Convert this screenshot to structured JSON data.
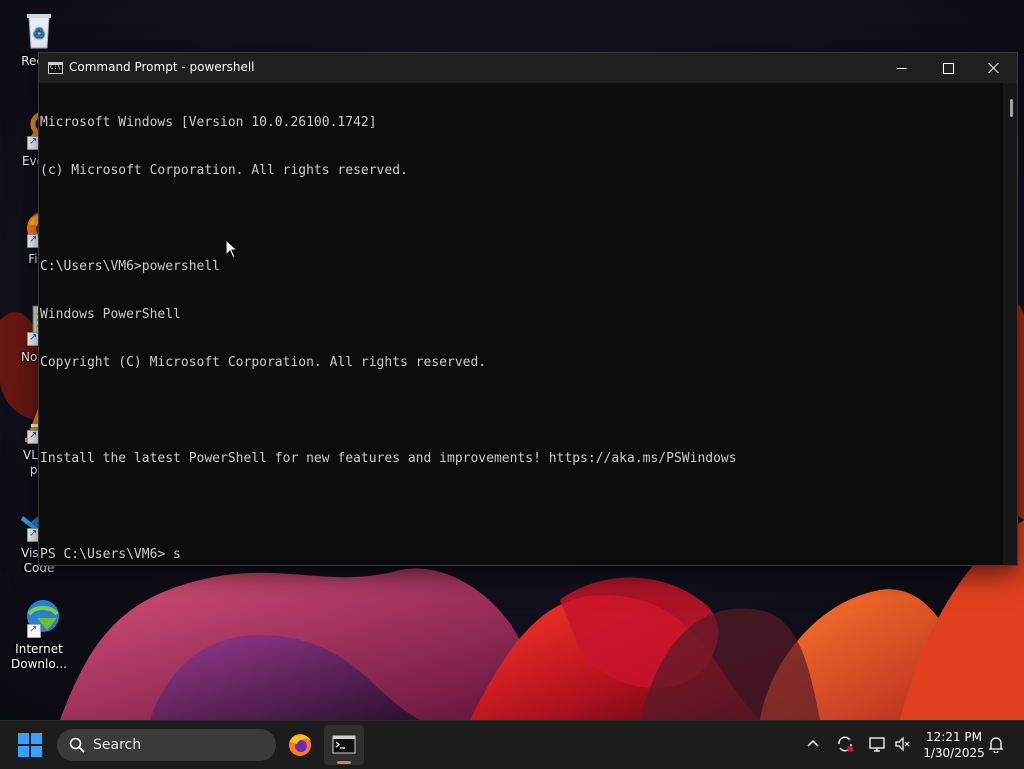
{
  "desktop": {
    "icons": [
      {
        "label": "Recyc",
        "icon": "recycle-bin-icon"
      },
      {
        "label": "Every",
        "icon": "everything-search-icon"
      },
      {
        "label": "Fire",
        "icon": "firefox-icon"
      },
      {
        "label": "Notep",
        "icon": "notepad-icon"
      },
      {
        "label_line1": "VLC r",
        "label_line2": "pla",
        "icon": "vlc-icon"
      },
      {
        "label_line1": "Visual",
        "label_line2": "Code",
        "icon": "vscode-icon"
      },
      {
        "label_line1": "Internet",
        "label_line2": "Downlo...",
        "icon": "internet-download-manager-icon"
      }
    ]
  },
  "window": {
    "title": "Command Prompt - powershell",
    "app_icon": "command-prompt-icon",
    "buttons": {
      "minimize": "minimize-icon",
      "maximize": "maximize-icon",
      "close": "close-icon"
    }
  },
  "console": {
    "lines": [
      "Microsoft Windows [Version 10.0.26100.1742]",
      "(c) Microsoft Corporation. All rights reserved.",
      "",
      "C:\\Users\\VM6>powershell",
      "Windows PowerShell",
      "Copyright (C) Microsoft Corporation. All rights reserved.",
      "",
      "Install the latest PowerShell for new features and improvements! https://aka.ms/PSWindows",
      "",
      "PS C:\\Users\\VM6> s"
    ]
  },
  "taskbar": {
    "search_label": "Search",
    "apps": [
      {
        "name": "Firefox",
        "icon": "firefox-icon"
      },
      {
        "name": "Command Prompt",
        "icon": "terminal-icon",
        "active": true
      }
    ],
    "tray_icons": [
      "chevron-up-icon",
      "sync-icon",
      "network-icon",
      "volume-muted-icon"
    ],
    "time": "12:21 PM",
    "date": "1/30/2025",
    "notification_icon": "bell-icon"
  },
  "colors": {
    "console_bg": "#0c0c0c",
    "console_text": "#cccccc",
    "titlebar_bg": "#1f1f1f",
    "taskbar_bg": "#1c1c1c",
    "accent_windows_blue": "#3aa0ff"
  }
}
